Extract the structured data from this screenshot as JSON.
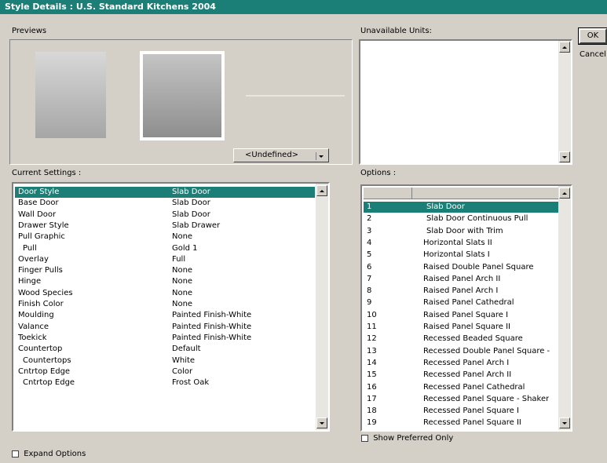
{
  "window": {
    "title": "Style Details : U.S. Standard Kitchens 2004"
  },
  "buttons": {
    "ok": "OK",
    "cancel": "Cancel"
  },
  "previews": {
    "label": "Previews",
    "dropdown_value": "<Undefined>"
  },
  "unavailable": {
    "label": "Unavailable Units:"
  },
  "current_settings": {
    "label": "Current Settings :",
    "rows": [
      {
        "name": "Door Style",
        "value": "Slab Door",
        "selected": true
      },
      {
        "name": "Base Door",
        "value": "Slab Door"
      },
      {
        "name": "Wall Door",
        "value": "Slab Door"
      },
      {
        "name": "Drawer Style",
        "value": "Slab Drawer"
      },
      {
        "name": "Pull Graphic",
        "value": "None"
      },
      {
        "name": "Pull",
        "value": "Gold 1"
      },
      {
        "name": "Overlay",
        "value": "Full"
      },
      {
        "name": "Finger Pulls",
        "value": "None"
      },
      {
        "name": "Hinge",
        "value": "None"
      },
      {
        "name": "Wood Species",
        "value": "None"
      },
      {
        "name": "Finish Color",
        "value": "None"
      },
      {
        "name": "Moulding",
        "value": "Painted Finish-White"
      },
      {
        "name": "Valance",
        "value": "Painted Finish-White"
      },
      {
        "name": "Toekick",
        "value": "Painted Finish-White"
      },
      {
        "name": "Countertop",
        "value": "Default"
      },
      {
        "name": "Countertops",
        "value": "White"
      },
      {
        "name": "Cntrtop Edge",
        "value": "Color"
      },
      {
        "name": "Cntrtop Edge",
        "value": "Frost Oak"
      }
    ]
  },
  "options": {
    "label": "Options :",
    "rows": [
      {
        "num": "1",
        "name": "Slab Door",
        "selected": true
      },
      {
        "num": "2",
        "name": "Slab Door Continuous Pull"
      },
      {
        "num": "3",
        "name": "Slab Door with Trim"
      },
      {
        "num": "4",
        "name": "Horizontal Slats II"
      },
      {
        "num": "5",
        "name": "Horizontal Slats I"
      },
      {
        "num": "6",
        "name": "Raised Double Panel Square"
      },
      {
        "num": "7",
        "name": "Raised Panel Arch II"
      },
      {
        "num": "8",
        "name": "Raised Panel Arch I"
      },
      {
        "num": "9",
        "name": "Raised Panel Cathedral"
      },
      {
        "num": "10",
        "name": "Raised Panel Square I"
      },
      {
        "num": "11",
        "name": "Raised Panel Square II"
      },
      {
        "num": "12",
        "name": "Recessed Beaded Square"
      },
      {
        "num": "13",
        "name": "Recessed Double Panel Square -"
      },
      {
        "num": "14",
        "name": "Recessed Panel Arch I"
      },
      {
        "num": "15",
        "name": "Recessed Panel Arch II"
      },
      {
        "num": "16",
        "name": "Recessed Panel Cathedral"
      },
      {
        "num": "17",
        "name": "Recessed Panel Square - Shaker"
      },
      {
        "num": "18",
        "name": "Recessed Panel Square I"
      },
      {
        "num": "19",
        "name": "Recessed Panel Square II"
      }
    ]
  },
  "checkboxes": {
    "show_preferred": "Show Preferred Only",
    "expand_options": "Expand Options"
  },
  "colors": {
    "title_bar": "#1b7f77",
    "selection": "#1b7f77",
    "dialog_bg": "#d4d0c8"
  }
}
